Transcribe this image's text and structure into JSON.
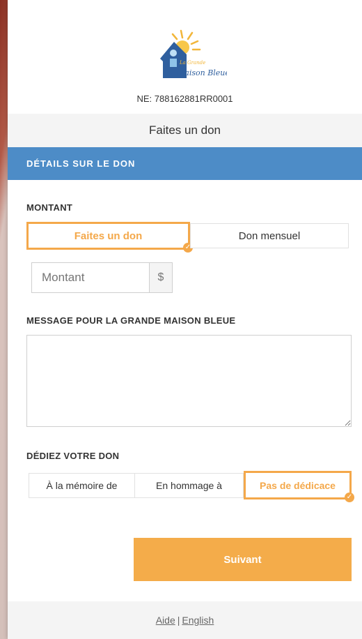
{
  "org": {
    "logo_text_line1": "La Grande",
    "logo_text_line2": "Maison Bleue",
    "ne": "NE: 788162881RR0001"
  },
  "header": {
    "title": "Faites un don"
  },
  "section": {
    "title": "DÉTAILS SUR LE DON"
  },
  "amount": {
    "label": "MONTANT",
    "options": [
      "Faites un don",
      "Don mensuel"
    ],
    "selected": "Faites un don",
    "placeholder": "Montant",
    "currency": "$"
  },
  "message": {
    "label": "MESSAGE POUR LA GRANDE MAISON BLEUE",
    "value": ""
  },
  "dedication": {
    "label": "DÉDIEZ VOTRE DON",
    "options": [
      "À la mémoire de",
      "En hommage à",
      "Pas de dédicace"
    ],
    "selected": "Pas de dédicace"
  },
  "actions": {
    "next": "Suivant"
  },
  "footer": {
    "help": "Aide",
    "separator": "|",
    "language": "English"
  },
  "colors": {
    "accent": "#f4a84a",
    "section": "#4d8cc7",
    "button": "#f4ac4a"
  }
}
